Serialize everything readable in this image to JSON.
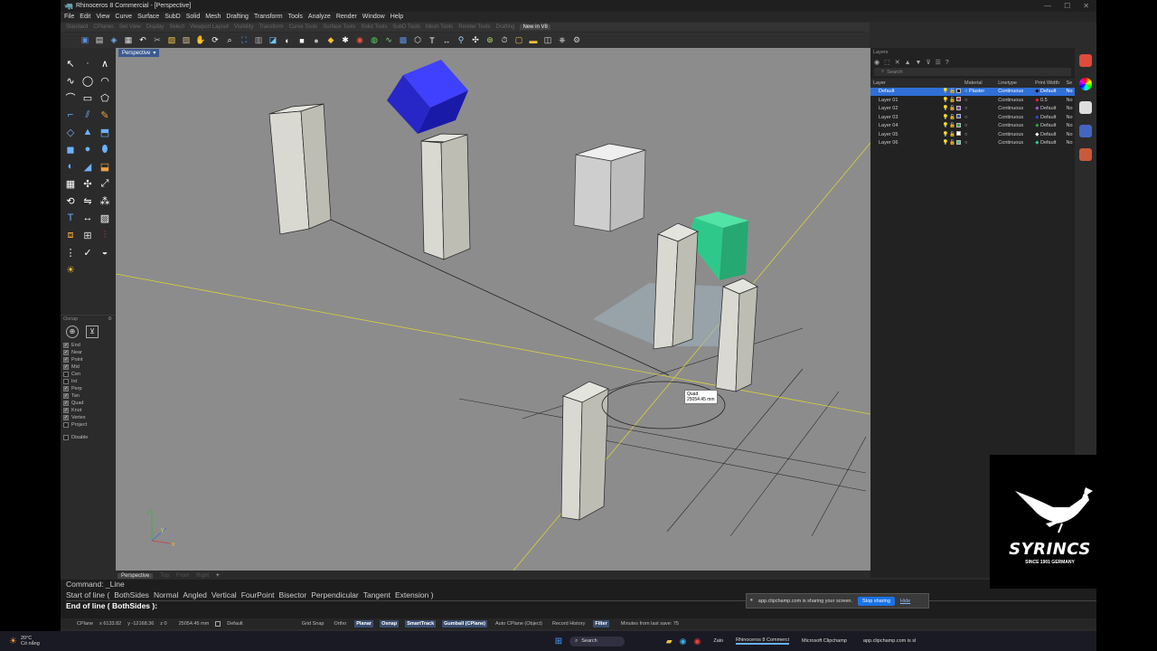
{
  "window": {
    "title": "Rhinoceros 8 Commercial - [Perspective]",
    "controls": [
      "—",
      "☐",
      "✕"
    ]
  },
  "menu": [
    "File",
    "Edit",
    "View",
    "Curve",
    "Surface",
    "SubD",
    "Solid",
    "Mesh",
    "Drafting",
    "Transform",
    "Tools",
    "Analyze",
    "Render",
    "Window",
    "Help"
  ],
  "toolbar_tabs": [
    "Standard",
    "CPlanes",
    "Set View",
    "Display",
    "Select",
    "Viewport Layout",
    "Visibility",
    "Transform",
    "Curve Tools",
    "Surface Tools",
    "Solid Tools",
    "SubD Tools",
    "Mesh Tools",
    "Render Tools",
    "Drafting",
    "New in V8"
  ],
  "active_tab": "New in V8",
  "viewport": {
    "label": "Perspective",
    "tabs": [
      "Perspective",
      "Top",
      "Front",
      "Right",
      "+"
    ],
    "active_tab": "Perspective"
  },
  "snap_tooltip": {
    "label": "Quad",
    "value": "25054.45 mm"
  },
  "axes": {
    "x": "x",
    "y": "y",
    "z": "z"
  },
  "osnap": {
    "title": "Osnap",
    "items": [
      {
        "label": "End",
        "checked": true
      },
      {
        "label": "Near",
        "checked": true
      },
      {
        "label": "Point",
        "checked": true
      },
      {
        "label": "Mid",
        "checked": true
      },
      {
        "label": "Cen",
        "checked": false
      },
      {
        "label": "Int",
        "checked": false
      },
      {
        "label": "Perp",
        "checked": true
      },
      {
        "label": "Tan",
        "checked": true
      },
      {
        "label": "Quad",
        "checked": true
      },
      {
        "label": "Knot",
        "checked": true
      },
      {
        "label": "Vertex",
        "checked": true
      },
      {
        "label": "Project",
        "checked": false
      }
    ],
    "disable": "Disable"
  },
  "layers": {
    "title": "Layers",
    "search_placeholder": "Search",
    "columns": [
      "Layer",
      "Material",
      "Linetype",
      "Print Width",
      "Se"
    ],
    "rows": [
      {
        "name": "Default",
        "material": "Plaster",
        "linetype": "Continuous",
        "width": "Default",
        "se": "No",
        "color": "#111111",
        "pcolor": "#000000",
        "selected": true
      },
      {
        "name": "Layer 01",
        "material": "",
        "linetype": "Continuous",
        "width": "0.5",
        "se": "No",
        "color": "#d62a2a",
        "pcolor": "#d62a2a",
        "selected": false
      },
      {
        "name": "Layer 02",
        "material": "",
        "linetype": "Continuous",
        "width": "Default",
        "se": "No",
        "color": "#7a37c8",
        "pcolor": "#9a5bd6",
        "selected": false
      },
      {
        "name": "Layer 03",
        "material": "",
        "linetype": "Continuous",
        "width": "Default",
        "se": "No",
        "color": "#2a48d6",
        "pcolor": "#2a48d6",
        "selected": false
      },
      {
        "name": "Layer 04",
        "material": "",
        "linetype": "Continuous",
        "width": "Default",
        "se": "No",
        "color": "#23a83a",
        "pcolor": "#23a83a",
        "selected": false
      },
      {
        "name": "Layer 05",
        "material": "",
        "linetype": "Continuous",
        "width": "Default",
        "se": "No",
        "color": "#ffffff",
        "pcolor": "#ffffff",
        "selected": false
      },
      {
        "name": "Layer 06",
        "material": "",
        "linetype": "Continuous",
        "width": "Default",
        "se": "No",
        "color": "#2ec98a",
        "pcolor": "#2ec98a",
        "selected": false
      }
    ]
  },
  "command": {
    "history": "Command: _Line",
    "prompt_prefix": "Start of line (",
    "options": [
      "BothSides",
      "Normal",
      "Angled",
      "Vertical",
      "FourPoint",
      "Bisector",
      "Perpendicular",
      "Tangent",
      "Extension"
    ],
    "prompt_suffix": ")",
    "current": "End of line ( BothSides ):"
  },
  "status": {
    "cplane": "CPlane",
    "x": "x 6133.82",
    "y": "y -12168.36",
    "z": "z 0",
    "distance": "25054.45 mm",
    "layer": "Default",
    "buttons": [
      {
        "label": "Grid Snap",
        "on": false
      },
      {
        "label": "Ortho",
        "on": false
      },
      {
        "label": "Planar",
        "on": true
      },
      {
        "label": "Osnap",
        "on": true
      },
      {
        "label": "SmartTrack",
        "on": true
      },
      {
        "label": "Gumball (CPlane)",
        "on": true
      },
      {
        "label": "Auto CPlane (Object)",
        "on": false
      },
      {
        "label": "Record History",
        "on": false
      },
      {
        "label": "Filter",
        "on": true
      }
    ],
    "save": "Minutes from last save: 75"
  },
  "share_banner": {
    "text": "app.clipchamp.com is sharing your screen.",
    "stop": "Stop sharing",
    "hide": "Hide"
  },
  "taskbar": {
    "weather_temp": "20°C",
    "weather_desc": "Có nắng",
    "search": "Search",
    "zalo": "Zalo",
    "rhino": "Rhinoceros 8 Commerci",
    "clipchamp": "Microsoft Clipchamp",
    "app": "app.clipchamp.com is sl"
  },
  "watermark": {
    "brand": "SYRINCS",
    "tagline": "SINCE 1901 GERMANY"
  },
  "colors": {
    "accent": "#2f6fd6",
    "viewport_bg": "#8c8c8c",
    "blue_box": "#2a2ad6",
    "green_box": "#2ec98a"
  }
}
